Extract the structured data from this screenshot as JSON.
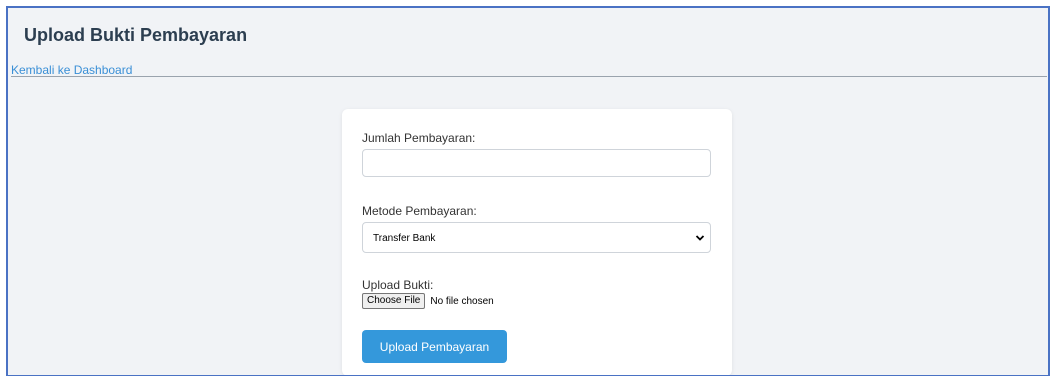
{
  "header": {
    "title": "Upload Bukti Pembayaran",
    "back_link": "Kembali ke Dashboard"
  },
  "form": {
    "amount_label": "Jumlah Pembayaran:",
    "amount_value": "",
    "method_label": "Metode Pembayaran:",
    "method_selected": "Transfer Bank",
    "upload_label": "Upload Bukti:",
    "file_button": "Choose File",
    "file_status": "No file chosen",
    "submit_label": "Upload Pembayaran"
  },
  "colors": {
    "frame_border": "#4a72c4",
    "background": "#f1f3f6",
    "link": "#3a8fd6",
    "submit": "#3498db",
    "title": "#2c3e50"
  }
}
